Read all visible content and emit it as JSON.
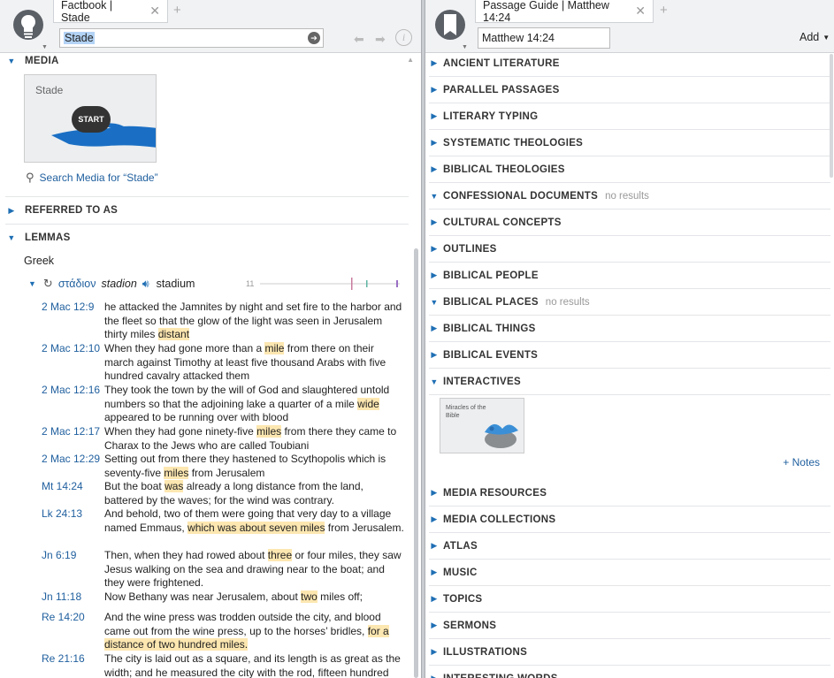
{
  "left": {
    "tab_title": "Factbook | Stade",
    "search_value": "Stade",
    "sections": {
      "media": "MEDIA",
      "referred": "REFERRED TO AS",
      "lemmas": "LEMMAS"
    },
    "media": {
      "thumb_label": "Stade",
      "start_label": "START",
      "search_link": "Search Media for “Stade”"
    },
    "lemmas": {
      "language": "Greek",
      "greek": "στάδιον",
      "translit": "stadion",
      "gloss": "stadium",
      "count": "11"
    },
    "verses": [
      {
        "ref": "2 Mac 12:9",
        "pre": "he attacked the Jamnites by night and set fire to the harbor and the fleet so that the glow of the light was seen in Jerusalem thirty miles ",
        "hl": "distant",
        "post": ""
      },
      {
        "ref": "2 Mac 12:10",
        "pre": "When they had gone more than a ",
        "hl": "mile",
        "post": " from there on their march against Timothy at least five thousand Arabs with five hundred cavalry attacked them"
      },
      {
        "ref": "2 Mac 12:16",
        "pre": "They took the town by the will of God and slaughtered untold numbers so that the adjoining lake a quarter of a mile ",
        "hl": "wide",
        "post": " appeared to be running over with blood"
      },
      {
        "ref": "2 Mac 12:17",
        "pre": "When they had gone ninety-five ",
        "hl": "miles",
        "post": " from there they came to Charax to the Jews who are called Toubiani"
      },
      {
        "ref": "2 Mac 12:29",
        "pre": "Setting out from there they hastened to Scythopolis which is seventy-five ",
        "hl": "miles",
        "post": " from Jerusalem"
      },
      {
        "ref": "Mt 14:24",
        "pre": "But the boat ",
        "hl": "was",
        "post": " already a long distance from the land, battered by the waves; for the wind was contrary."
      },
      {
        "ref": "Lk 24:13",
        "pre": "And behold, two of them were going that very day to a village named Emmaus, ",
        "hl": "which was about seven miles",
        "post": " from Jerusalem."
      },
      {
        "ref": "Jn 6:19",
        "pre": "Then, when they had rowed about ",
        "hl": "three",
        "post": " or four miles, they saw Jesus walking on the sea and drawing near to the boat; and they were frightened."
      },
      {
        "ref": "Jn 11:18",
        "pre": "Now Bethany was near Jerusalem, about ",
        "hl": "two",
        "post": " miles off;"
      },
      {
        "ref": "Re 14:20",
        "pre": "And the wine press was trodden outside the city, and blood came out from the wine press, up to the horses’ bridles, ",
        "hl": "for a distance of two hundred miles.",
        "post": ""
      },
      {
        "ref": "Re 21:16",
        "pre": "The city is laid out as a square, and its length is as great as the width; and he measured the city with the rod, fifteen hundred",
        "hl": "",
        "post": ""
      }
    ]
  },
  "right": {
    "tab_title": "Passage Guide | Matthew 14:24",
    "reference_value": "Matthew 14:24",
    "add_label": "Add",
    "interactive_thumb": "Miracles of the Bible",
    "notes_link": "+ Notes",
    "sections": [
      {
        "label": "ANCIENT LITERATURE",
        "open": false,
        "nores": ""
      },
      {
        "label": "PARALLEL PASSAGES",
        "open": false,
        "nores": ""
      },
      {
        "label": "LITERARY TYPING",
        "open": false,
        "nores": ""
      },
      {
        "label": "SYSTEMATIC THEOLOGIES",
        "open": false,
        "nores": ""
      },
      {
        "label": "BIBLICAL THEOLOGIES",
        "open": false,
        "nores": ""
      },
      {
        "label": "CONFESSIONAL DOCUMENTS",
        "open": true,
        "nores": "no results"
      },
      {
        "label": "CULTURAL CONCEPTS",
        "open": false,
        "nores": ""
      },
      {
        "label": "OUTLINES",
        "open": false,
        "nores": ""
      },
      {
        "label": "BIBLICAL PEOPLE",
        "open": false,
        "nores": ""
      },
      {
        "label": "BIBLICAL PLACES",
        "open": true,
        "nores": "no results"
      },
      {
        "label": "BIBLICAL THINGS",
        "open": false,
        "nores": ""
      },
      {
        "label": "BIBLICAL EVENTS",
        "open": false,
        "nores": ""
      },
      {
        "label": "INTERACTIVES",
        "open": true,
        "nores": ""
      }
    ],
    "sections_after": [
      {
        "label": "MEDIA RESOURCES",
        "open": false,
        "nores": ""
      },
      {
        "label": "MEDIA COLLECTIONS",
        "open": false,
        "nores": ""
      },
      {
        "label": "ATLAS",
        "open": false,
        "nores": ""
      },
      {
        "label": "MUSIC",
        "open": false,
        "nores": ""
      },
      {
        "label": "TOPICS",
        "open": false,
        "nores": ""
      },
      {
        "label": "SERMONS",
        "open": false,
        "nores": ""
      },
      {
        "label": "ILLUSTRATIONS",
        "open": false,
        "nores": ""
      },
      {
        "label": "INTERESTING WORDS",
        "open": false,
        "nores": ""
      }
    ]
  },
  "colors": {
    "accent": "#1f6fb4",
    "link": "#1f5f9e",
    "highlight": "#fde7b1",
    "water": "#1a6fc4"
  }
}
